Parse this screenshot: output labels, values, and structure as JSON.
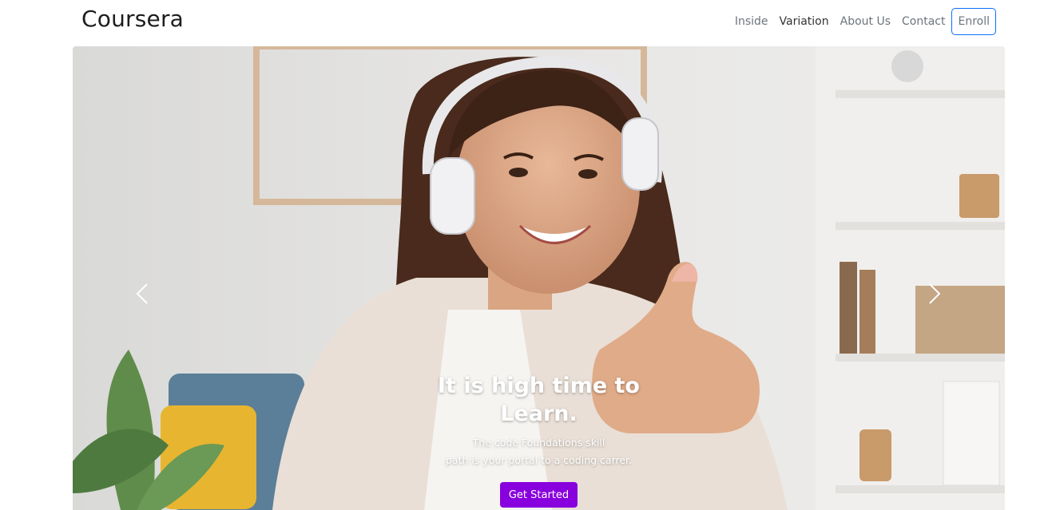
{
  "brand": "Coursera",
  "nav": {
    "links": [
      "Inside",
      "Variation",
      "About Us",
      "Contact"
    ],
    "enroll_label": "Enroll"
  },
  "hero": {
    "image_semantic": "woman-with-headphones-thumbs-up-photo",
    "title": "It is high time to Learn.",
    "text_line1": "The code Foundations skill",
    "text_line2": "path is your portal to a coding carrer.",
    "cta_label": "Get Started",
    "prev_icon": "chevron-left-icon",
    "next_icon": "chevron-right-icon"
  },
  "colors": {
    "accent": "#8800dd",
    "enroll_border": "#0d6efd",
    "nav_text": "#6c757d"
  }
}
